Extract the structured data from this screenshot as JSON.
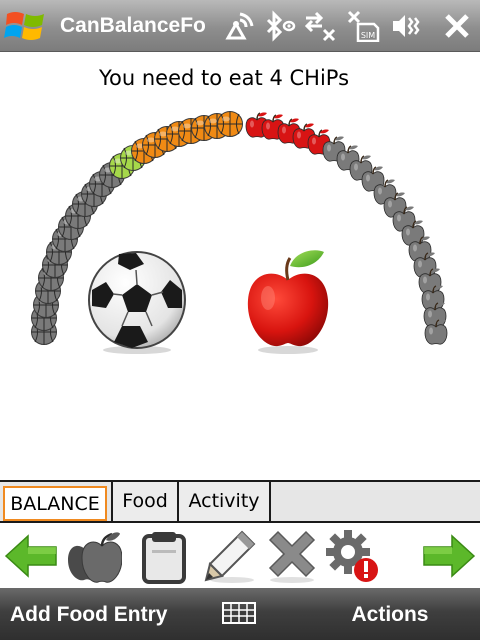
{
  "title_bar": {
    "app_title": "CanBalanceFo",
    "status_icons": [
      "antenna-icon",
      "bluetooth-icon",
      "data-sync-off-icon",
      "no-sim-icon",
      "volume-vibrate-icon",
      "close-icon"
    ]
  },
  "main": {
    "instruction": "You need to eat 4 CHiPs",
    "balance_arc": {
      "activity_ball_colors": [
        "gray",
        "gray",
        "gray",
        "gray",
        "gray",
        "gray",
        "gray",
        "gray",
        "gray",
        "gray",
        "gray",
        "gray",
        "gray",
        "gray",
        "green",
        "green",
        "orange",
        "orange",
        "orange",
        "orange",
        "orange",
        "orange",
        "orange",
        "orange"
      ],
      "food_apple_colors": [
        "red",
        "red",
        "red",
        "red",
        "red",
        "gray",
        "gray",
        "gray",
        "gray",
        "gray",
        "gray",
        "gray",
        "gray",
        "gray",
        "gray",
        "gray",
        "gray",
        "gray",
        "gray"
      ],
      "colors": {
        "gray": "#7a7a7a",
        "green": "#a6d84a",
        "orange": "#f08a14",
        "red": "#d81414"
      }
    },
    "activity_symbol": "soccer-ball-icon",
    "food_symbol": "apple-icon"
  },
  "tabs": [
    {
      "label": "BALANCE",
      "selected": true
    },
    {
      "label": "Food",
      "selected": false
    },
    {
      "label": "Activity",
      "selected": false
    }
  ],
  "toolbar": {
    "buttons": [
      "back-arrow-icon",
      "apples-icon",
      "clipboard-icon",
      "pencil-icon",
      "delete-x-icon",
      "settings-alert-icon",
      "forward-arrow-icon"
    ]
  },
  "softkeys": {
    "left": "Add Food Entry",
    "right": "Actions"
  },
  "accent": "#f08a20"
}
